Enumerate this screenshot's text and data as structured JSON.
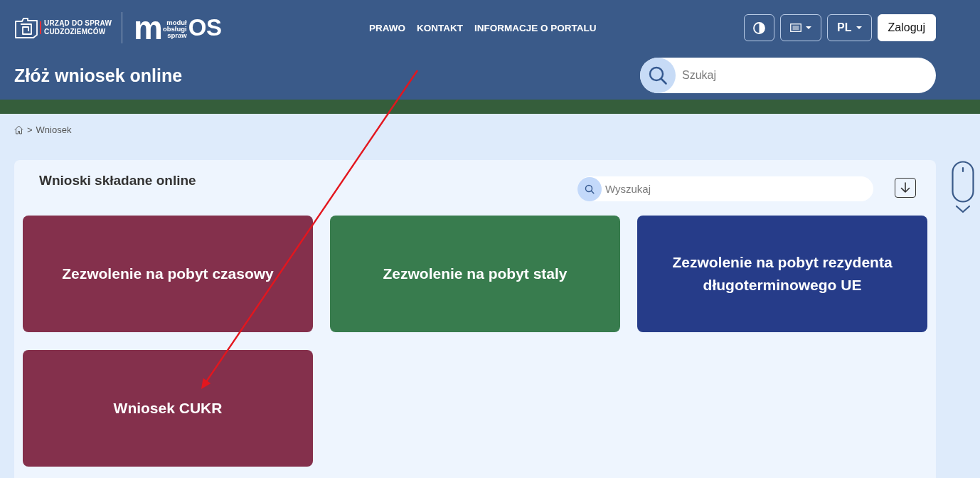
{
  "header": {
    "agency_logo": {
      "lines": [
        "URZĄD DO SPRAW",
        "CUDZOZIEMCÓW"
      ]
    },
    "module_logo": {
      "letter": "m",
      "tagline": [
        "moduł",
        "obsługi",
        "spraw"
      ],
      "suffix": "OS"
    },
    "nav": [
      "PRAWO",
      "KONTAKT",
      "INFORMACJE O PORTALU"
    ],
    "toolbar": [
      {
        "kind": "contrast",
        "dropdown": false
      },
      {
        "kind": "display",
        "dropdown": true
      },
      {
        "kind": "language",
        "label": "PL",
        "dropdown": true
      },
      {
        "kind": "login",
        "label": "Zaloguj",
        "dropdown": false
      }
    ],
    "page_title": "Złóż wniosek online",
    "search": {
      "placeholder": "Szukaj"
    }
  },
  "breadcrumb": {
    "separator": ">",
    "items": [
      "Wniosek"
    ]
  },
  "panel": {
    "title": "Wnioski składane online",
    "search": {
      "placeholder": "Wyszukaj"
    },
    "tiles": [
      {
        "label": "Zezwolenie na pobyt czasowy",
        "color": "#84304c"
      },
      {
        "label": "Zezwolenie na pobyt staly",
        "color": "#387c4e"
      },
      {
        "label": "Zezwolenie na pobyt rezydenta długoterminowego UE",
        "color": "#263c89"
      },
      {
        "label": "Wniosek CUKR",
        "color": "#84304c"
      }
    ]
  },
  "annotations": [
    {
      "kind": "arrow"
    }
  ]
}
